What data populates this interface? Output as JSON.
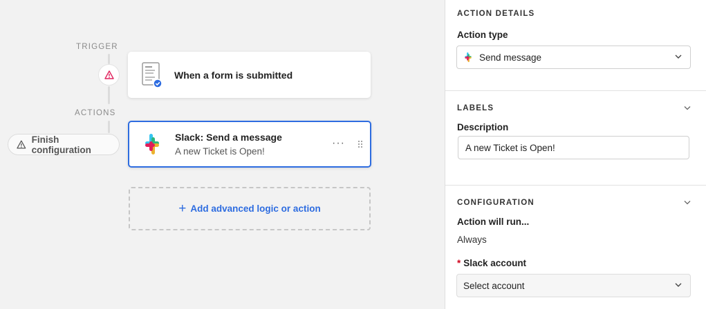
{
  "canvas": {
    "trigger_label": "TRIGGER",
    "actions_label": "ACTIONS",
    "trigger_card": {
      "title": "When a form is submitted",
      "icon": "form-icon"
    },
    "action_card": {
      "title": "Slack: Send a message",
      "subtitle": "A new Ticket is Open!",
      "icon": "slack-icon",
      "more_label": "···"
    },
    "finish_button": {
      "label": "Finish configuration",
      "icon": "warning-icon"
    },
    "add_button": {
      "plus": "+",
      "label": "Add advanced logic or action"
    }
  },
  "panel": {
    "action_details": {
      "heading": "ACTION DETAILS",
      "action_type_label": "Action type",
      "action_type_value": "Send message"
    },
    "labels": {
      "heading": "LABELS",
      "description_label": "Description",
      "description_value": "A new Ticket is Open!"
    },
    "configuration": {
      "heading": "CONFIGURATION",
      "run_label": "Action will run...",
      "run_value": "Always",
      "required_mark": "*",
      "slack_account_label": "Slack account",
      "slack_account_value": "Select account"
    }
  },
  "colors": {
    "accent": "#2d6ce0",
    "warning": "#e0245e",
    "required": "#d0021b"
  }
}
